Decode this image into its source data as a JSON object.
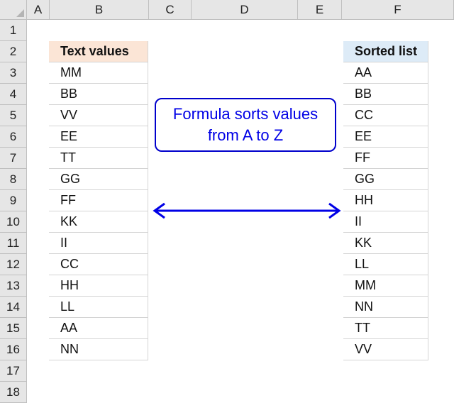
{
  "columns": [
    "A",
    "B",
    "C",
    "D",
    "E",
    "F"
  ],
  "rows": [
    "1",
    "2",
    "3",
    "4",
    "5",
    "6",
    "7",
    "8",
    "9",
    "10",
    "11",
    "12",
    "13",
    "14",
    "15",
    "16",
    "17",
    "18"
  ],
  "text_values": {
    "header": "Text values",
    "items": [
      "MM",
      "BB",
      "VV",
      "EE",
      "TT",
      "GG",
      "FF",
      "KK",
      "II",
      "CC",
      "HH",
      "LL",
      "AA",
      "NN"
    ]
  },
  "sorted_list": {
    "header": "Sorted list",
    "items": [
      "AA",
      "BB",
      "CC",
      "EE",
      "FF",
      "GG",
      "HH",
      "II",
      "KK",
      "LL",
      "MM",
      "NN",
      "TT",
      "VV"
    ]
  },
  "callout": {
    "line1": "Formula sorts values",
    "line2": "from A to Z"
  },
  "colors": {
    "accent_blue": "#0000e6",
    "header_orange": "#fbe5d6",
    "header_blue": "#ddebf7"
  },
  "icons": {
    "arrow": "double-headed-arrow-icon"
  }
}
